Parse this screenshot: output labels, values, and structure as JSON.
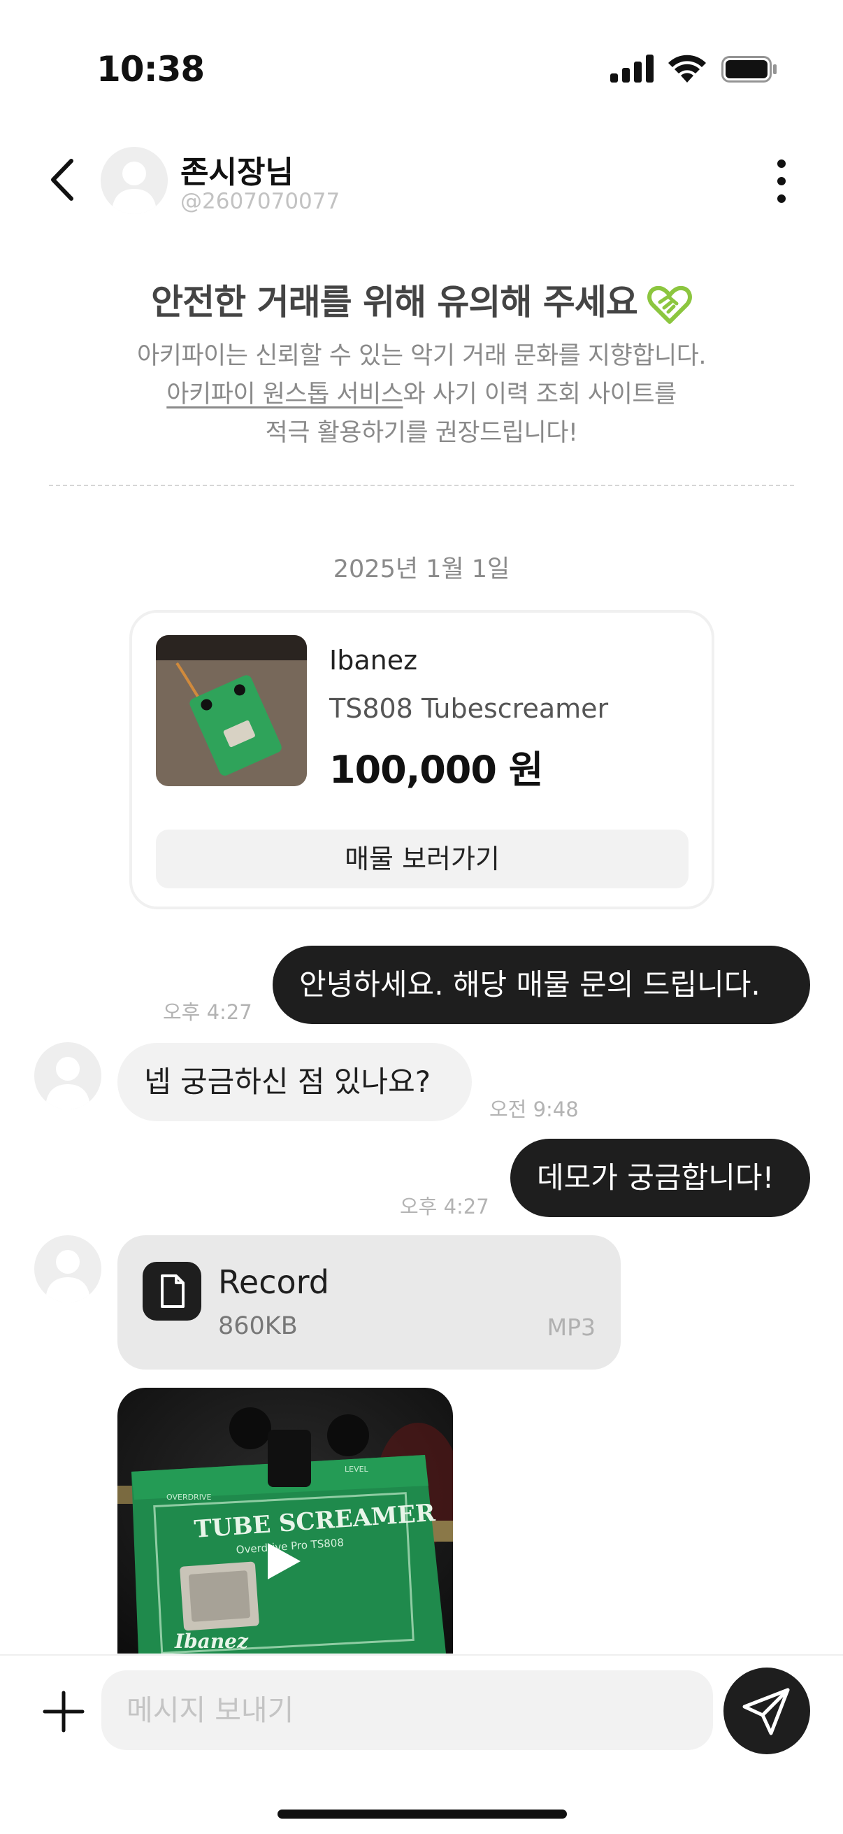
{
  "status_bar": {
    "time": "10:38",
    "icons": [
      "cellular-signal-icon",
      "wifi-icon",
      "battery-icon"
    ]
  },
  "header": {
    "name": "존시장님",
    "handle": "@2607070077",
    "icons": [
      "chevron-left-icon",
      "avatar-placeholder-icon",
      "more-vertical-icon"
    ]
  },
  "notice": {
    "title": "안전한 거래를 위해 유의해 주세요",
    "line1": "아키파이는 신뢰할 수 있는 악기 거래 문화를 지향합니다.",
    "line2_link": "아키파이 원스톱 서비스",
    "line2_rest": "와 사기 이력 조회 사이트를",
    "line3": "적극 활용하기를 권장드립니다!",
    "icon": "handshake-heart-icon",
    "accent_color": "#8cc63f"
  },
  "date": "2025년 1월 1일",
  "product": {
    "brand": "Ibanez",
    "model": "TS808 Tubescreamer",
    "price": "100,000 원",
    "button_label": "매물 보러가기"
  },
  "messages": [
    {
      "direction": "out",
      "text": "안녕하세요. 해당 매물 문의 드립니다.",
      "time": "오후 4:27"
    },
    {
      "direction": "in",
      "text": "넵 궁금하신 점 있나요?",
      "time": "오전 9:48"
    },
    {
      "direction": "out",
      "text": "데모가 궁금합니다!",
      "time": "오후 4:27"
    }
  ],
  "attachment": {
    "name": "Record",
    "size": "860KB",
    "type": "MP3",
    "icon": "document-icon"
  },
  "video": {
    "icon": "play-icon",
    "pedal_text": "TUBE SCREAMER",
    "pedal_subtext": "Overdrive Pro  TS808",
    "pedal_logo": "Ibanez",
    "knob_left": "OVERDRIVE",
    "knob_right": "LEVEL"
  },
  "composer": {
    "placeholder": "메시지 보내기",
    "icons": [
      "plus-icon",
      "send-icon"
    ]
  },
  "colors": {
    "bubble_out": "#1e1e1e",
    "bubble_in": "#f2f2f2",
    "text_muted": "#8a8a8a"
  }
}
